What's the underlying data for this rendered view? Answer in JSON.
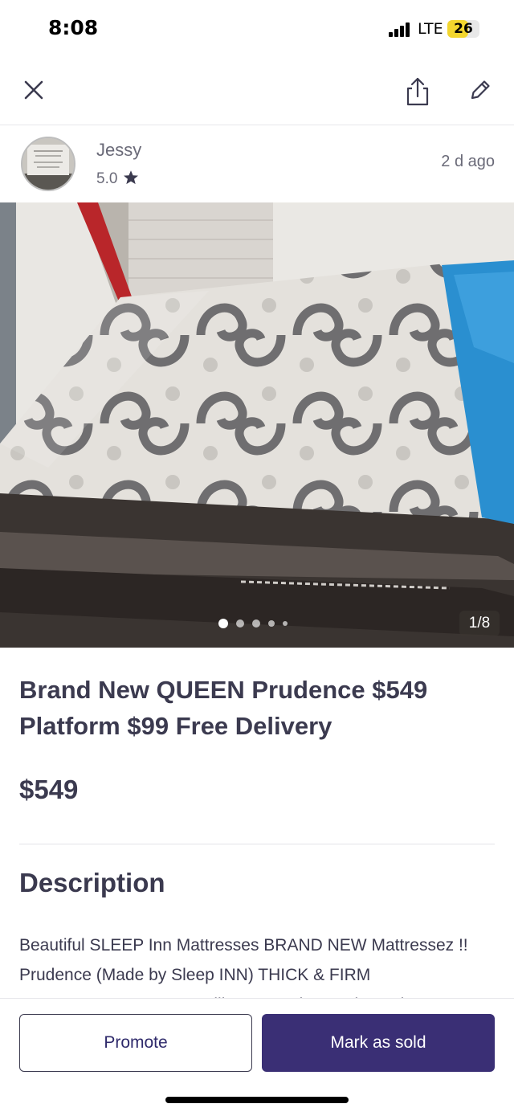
{
  "status_bar": {
    "time": "8:08",
    "network": "LTE",
    "battery_level": "26",
    "battery_fraction": 0.26,
    "battery_color": "#f3d62e"
  },
  "nav": {
    "close_icon": "close-icon",
    "share_icon": "share-icon",
    "edit_icon": "pencil-icon"
  },
  "seller": {
    "name": "Jessy",
    "rating": "5.0",
    "posted": "2 d  ago"
  },
  "photo": {
    "counter": "1/8",
    "dots_count": 5,
    "active_dot": 0
  },
  "listing": {
    "title": "Brand New QUEEN Prudence $549 Platform $99 Free Delivery",
    "price": "$549",
    "description_heading": "Description",
    "description": "Beautiful SLEEP Inn Mattresses BRAND NEW Mattressez !! Prudence (Made by Sleep INN) THICK & FIRM PILLOWTOPS!!! Queen Pillowtops & box spring only"
  },
  "actions": {
    "promote": "Promote",
    "mark_sold": "Mark as sold"
  },
  "colors": {
    "primary": "#3a2f75",
    "text": "#3b3a4f",
    "muted": "#6a6a78"
  }
}
